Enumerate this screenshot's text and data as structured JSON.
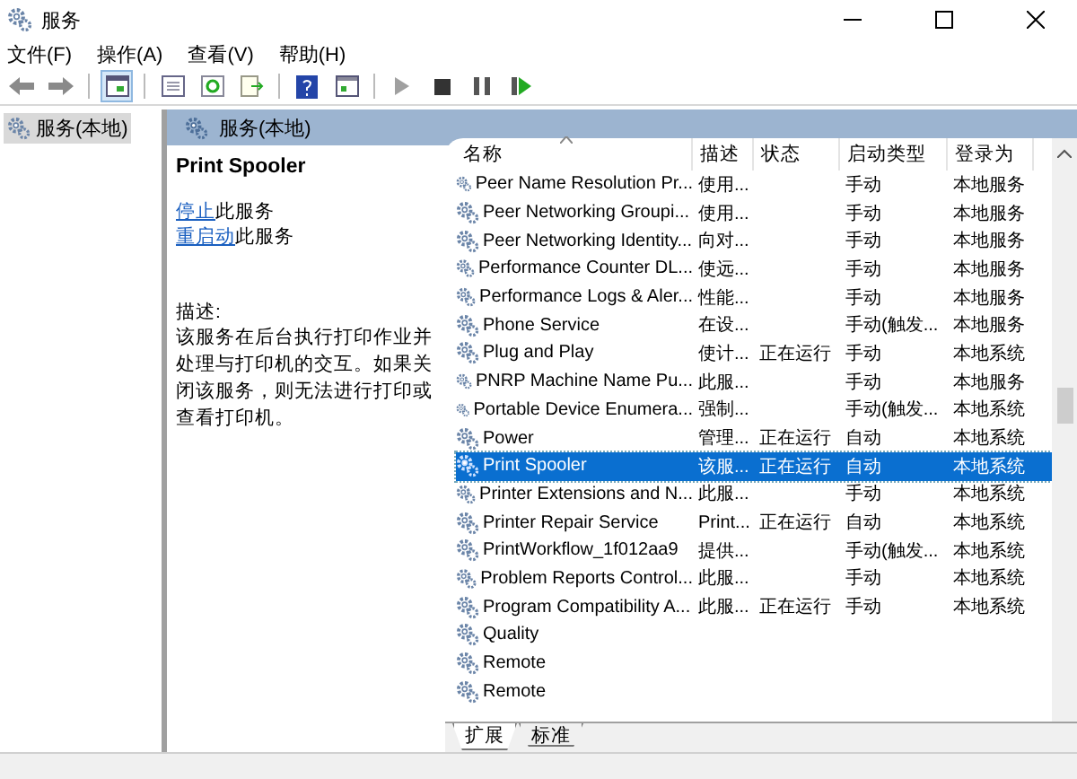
{
  "window": {
    "title": "服务"
  },
  "menu": [
    "文件(F)",
    "操作(A)",
    "查看(V)",
    "帮助(H)"
  ],
  "tree": [
    {
      "label": "服务(本地)",
      "selected": true
    }
  ],
  "panel_title": "服务(本地)",
  "details": {
    "service_name": "Print Spooler",
    "actions": [
      {
        "link": "停止",
        "text": "此服务"
      },
      {
        "link": "重启动",
        "text": "此服务"
      }
    ],
    "description_label": "描述:",
    "description": "该服务在后台执行打印作业并处理与打印机的交互。如果关闭该服务，则无法进行打印或查看打印机。"
  },
  "table": {
    "columns": [
      {
        "label": "名称",
        "sorted": true
      },
      {
        "label": "描述",
        "sorted": false
      },
      {
        "label": "状态",
        "sorted": false
      },
      {
        "label": "启动类型",
        "sorted": false
      },
      {
        "label": "登录为",
        "sorted": false
      }
    ],
    "rows": [
      {
        "name": "Peer Name Resolution Pr...",
        "description": "使用...",
        "status": "",
        "startup": "手动",
        "logon": "本地服务",
        "selected": false
      },
      {
        "name": "Peer Networking Groupi...",
        "description": "使用...",
        "status": "",
        "startup": "手动",
        "logon": "本地服务",
        "selected": false
      },
      {
        "name": "Peer Networking Identity...",
        "description": "向对...",
        "status": "",
        "startup": "手动",
        "logon": "本地服务",
        "selected": false
      },
      {
        "name": "Performance Counter DL...",
        "description": "使远...",
        "status": "",
        "startup": "手动",
        "logon": "本地服务",
        "selected": false
      },
      {
        "name": "Performance Logs & Aler...",
        "description": "性能...",
        "status": "",
        "startup": "手动",
        "logon": "本地服务",
        "selected": false
      },
      {
        "name": "Phone Service",
        "description": "在设...",
        "status": "",
        "startup": "手动(触发...",
        "logon": "本地服务",
        "selected": false
      },
      {
        "name": "Plug and Play",
        "description": "使计...",
        "status": "正在运行",
        "startup": "手动",
        "logon": "本地系统",
        "selected": false
      },
      {
        "name": "PNRP Machine Name Pu...",
        "description": "此服...",
        "status": "",
        "startup": "手动",
        "logon": "本地服务",
        "selected": false
      },
      {
        "name": "Portable Device Enumera...",
        "description": "强制...",
        "status": "",
        "startup": "手动(触发...",
        "logon": "本地系统",
        "selected": false
      },
      {
        "name": "Power",
        "description": "管理...",
        "status": "正在运行",
        "startup": "自动",
        "logon": "本地系统",
        "selected": false
      },
      {
        "name": "Print Spooler",
        "description": "该服...",
        "status": "正在运行",
        "startup": "自动",
        "logon": "本地系统",
        "selected": true
      },
      {
        "name": "Printer Extensions and N...",
        "description": "此服...",
        "status": "",
        "startup": "手动",
        "logon": "本地系统",
        "selected": false
      },
      {
        "name": "Printer Repair Service",
        "description": "Print...",
        "status": "正在运行",
        "startup": "自动",
        "logon": "本地系统",
        "selected": false
      },
      {
        "name": "PrintWorkflow_1f012aa9",
        "description": "提供...",
        "status": "",
        "startup": "手动(触发...",
        "logon": "本地系统",
        "selected": false
      },
      {
        "name": "Problem Reports Control...",
        "description": "此服...",
        "status": "",
        "startup": "手动",
        "logon": "本地系统",
        "selected": false
      },
      {
        "name": "Program Compatibility A...",
        "description": "此服...",
        "status": "正在运行",
        "startup": "手动",
        "logon": "本地系统",
        "selected": false
      },
      {
        "name": "Quality",
        "description": "",
        "status": "",
        "startup": "",
        "logon": "",
        "selected": false
      },
      {
        "name": "Remote",
        "description": "",
        "status": "",
        "startup": "",
        "logon": "",
        "selected": false
      },
      {
        "name": "Remote",
        "description": "",
        "status": "",
        "startup": "",
        "logon": "",
        "selected": false
      }
    ]
  },
  "tabs": [
    {
      "label": "扩展",
      "selected": true
    },
    {
      "label": "标准",
      "selected": false
    }
  ]
}
